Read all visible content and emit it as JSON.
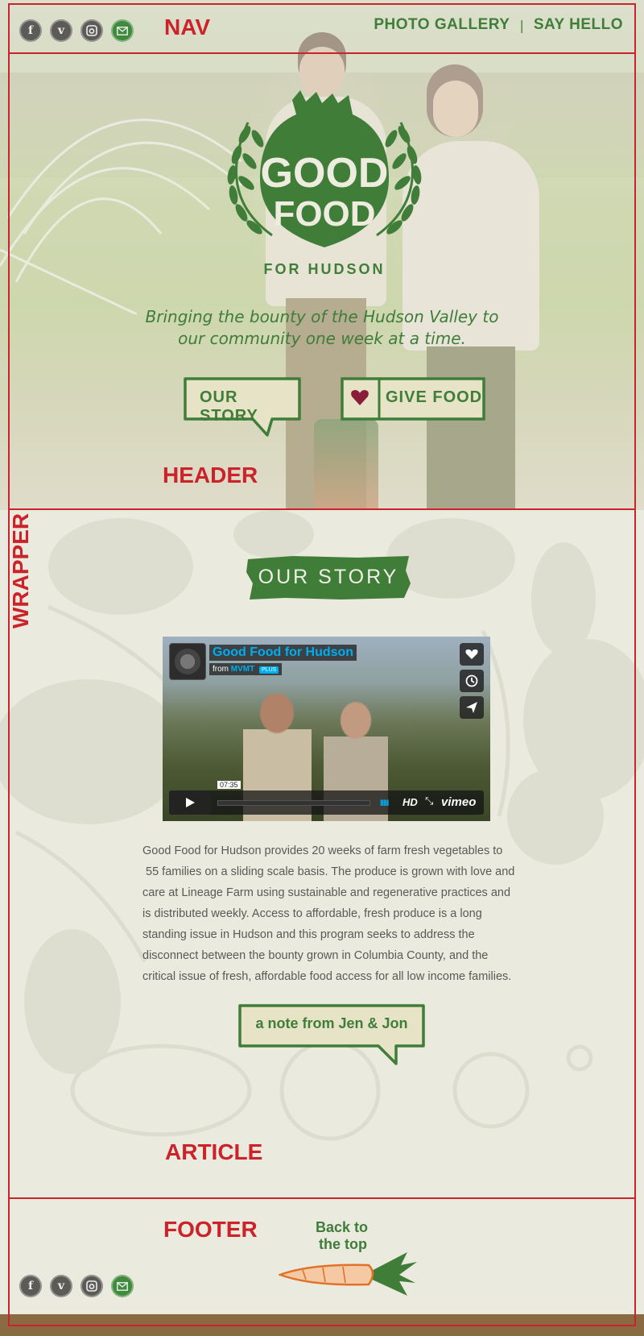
{
  "nav": {
    "social": [
      {
        "name": "facebook",
        "glyph": "f"
      },
      {
        "name": "vimeo",
        "glyph": "v"
      },
      {
        "name": "instagram",
        "glyph": "◘"
      },
      {
        "name": "email",
        "glyph": "✉"
      }
    ],
    "links": [
      "PHOTO GALLERY",
      "SAY HELLO"
    ],
    "separator": "|",
    "annotation": "NAV"
  },
  "header": {
    "logo": {
      "line1": "GOOD",
      "line2": "FOOD",
      "sub": "FOR HUDSON"
    },
    "tagline_line1": "Bringing the bounty of the Hudson Valley to",
    "tagline_line2": "our community one week at a time.",
    "btn_story": "OUR STORY",
    "btn_give": "GIVE FOOD",
    "annotation": "HEADER"
  },
  "wrapper": {
    "annotation": "WRAPPER"
  },
  "article": {
    "section_title": "OUR STORY",
    "video": {
      "title": "Good Food for Hudson",
      "from_label": "from",
      "channel": "MVMT",
      "badge": "PLUS",
      "time": "07:35",
      "hd": "HD",
      "brand": "vimeo",
      "volume": "IIIII"
    },
    "body_lines": [
      "Good Food for Hudson provides 20 weeks of farm fresh vegetables to",
      " 55 families on a sliding scale basis. The produce is grown with love and",
      "care at Lineage Farm using sustainable and regenerative practices and",
      "is distributed weekly. Access to affordable, fresh produce is a long",
      "standing issue in Hudson and this program seeks to address the",
      "disconnect between the bounty grown in Columbia County, and the",
      "critical issue of fresh, affordable food access for all low income families."
    ],
    "note_btn": "a note from Jen & Jon",
    "annotation": "ARTICLE"
  },
  "footer": {
    "back_line1": "Back to",
    "back_line2": "the top",
    "annotation": "FOOTER"
  },
  "colors": {
    "brand_green": "#3f7d39",
    "annotation_red": "#cc2229",
    "paper": "#ebeadf",
    "carrot": "#e0732a"
  }
}
